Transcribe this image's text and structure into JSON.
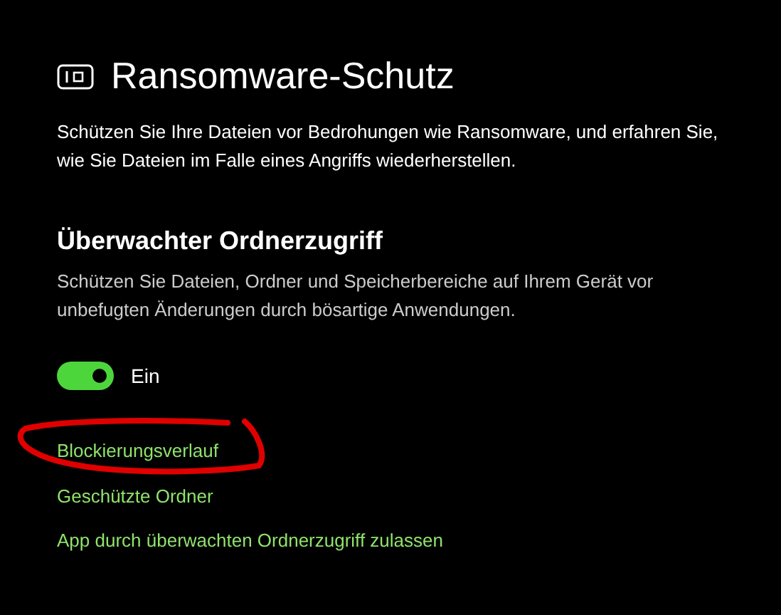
{
  "page": {
    "title": "Ransomware-Schutz",
    "description": "Schützen Sie Ihre Dateien vor Bedrohungen wie Ransomware, und erfahren Sie, wie Sie Dateien im Falle eines Angriffs wiederherstellen."
  },
  "section": {
    "title": "Überwachter Ordnerzugriff",
    "description": "Schützen Sie Dateien, Ordner und Speicherbereiche auf Ihrem Gerät vor unbefugten Änderungen durch bösartige Anwendungen.",
    "toggle": {
      "on": true,
      "label": "Ein"
    }
  },
  "links": [
    {
      "label": "Blockierungsverlauf"
    },
    {
      "label": "Geschützte Ordner"
    },
    {
      "label": "App durch überwachten Ordnerzugriff zulassen"
    }
  ]
}
